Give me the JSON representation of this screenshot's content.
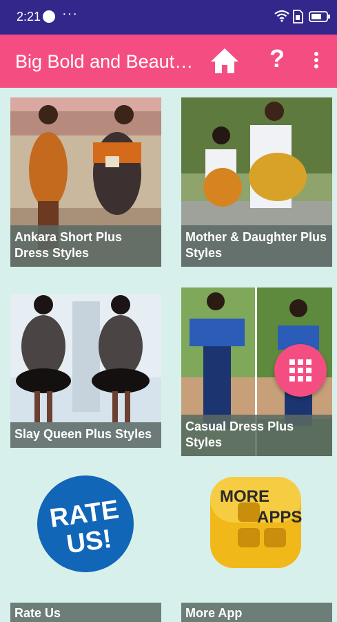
{
  "status_bar": {
    "time": "2:21",
    "more": "···"
  },
  "app_bar": {
    "title": "Big Bold and Beautiful"
  },
  "cards": [
    {
      "caption": "Ankara Short Plus Dress Styles"
    },
    {
      "caption": "Mother & Daughter Plus Styles"
    },
    {
      "caption": "Slay Queen Plus Styles"
    },
    {
      "caption": "Casual Dress Plus Styles"
    },
    {
      "caption": "Rate Us",
      "badge_line1": "RATE",
      "badge_line2": "US!"
    },
    {
      "caption": "More App",
      "badge_line1": "MORE",
      "badge_line2": "APPS"
    }
  ],
  "colors": {
    "status_bar": "#33278c",
    "app_bar": "#f44d81",
    "background": "#d8f0ec",
    "fab": "#f44d81"
  }
}
